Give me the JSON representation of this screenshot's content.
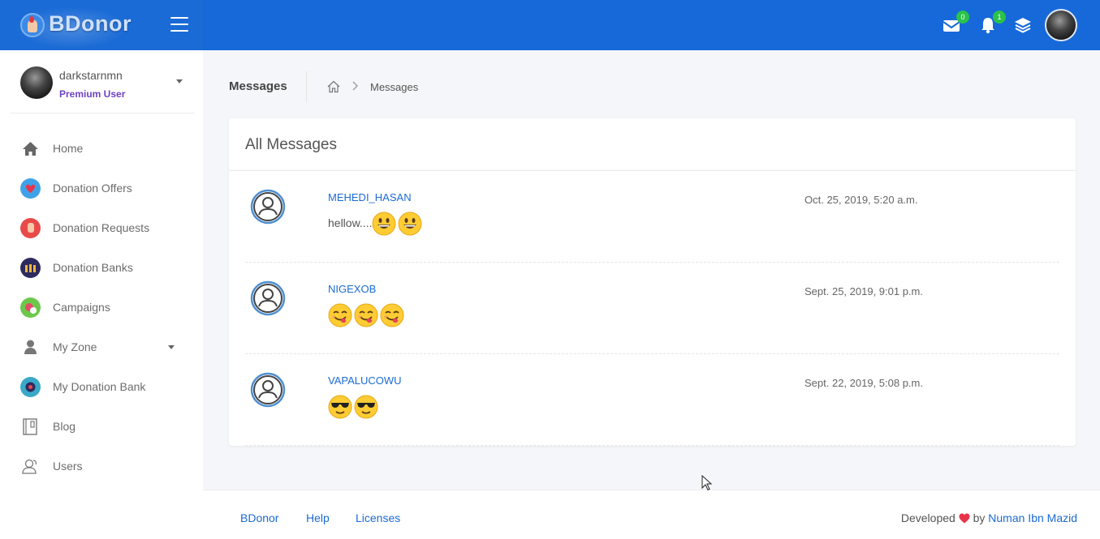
{
  "brand": {
    "name": "BDonor"
  },
  "header": {
    "mail_count": "0",
    "notification_count": "1"
  },
  "user": {
    "name": "darkstarnmn",
    "role": "Premium User"
  },
  "sidebar": {
    "items": [
      {
        "label": "Home",
        "icon": "home-icon"
      },
      {
        "label": "Donation Offers",
        "icon": "heart-hand-icon"
      },
      {
        "label": "Donation Requests",
        "icon": "hand-request-icon"
      },
      {
        "label": "Donation Banks",
        "icon": "people-bank-icon"
      },
      {
        "label": "Campaigns",
        "icon": "campaign-icon"
      },
      {
        "label": "My Zone",
        "icon": "user-icon"
      },
      {
        "label": "My Donation Bank",
        "icon": "bank-icon"
      },
      {
        "label": "Blog",
        "icon": "notebook-icon"
      },
      {
        "label": "Users",
        "icon": "users-icon"
      }
    ]
  },
  "page": {
    "title": "Messages",
    "breadcrumb_current": "Messages"
  },
  "card": {
    "title": "All Messages"
  },
  "messages": [
    {
      "sender": "MEHEDI_HASAN",
      "text": "hellow....",
      "date": "Oct. 25, 2019, 5:20 a.m.",
      "emoji": "grinning",
      "emoji_count": 2
    },
    {
      "sender": "NIGEXOB",
      "text": "",
      "date": "Sept. 25, 2019, 9:01 p.m.",
      "emoji": "yum",
      "emoji_count": 3
    },
    {
      "sender": "VAPALUCOWU",
      "text": "",
      "date": "Sept. 22, 2019, 5:08 p.m.",
      "emoji": "sunglasses",
      "emoji_count": 2
    }
  ],
  "footer": {
    "links": [
      "BDonor",
      "Help",
      "Licenses"
    ],
    "developed": "Developed",
    "by": "by",
    "author": "Numan Ibn Mazid"
  },
  "colors": {
    "primary": "#1769d9",
    "badge": "#2bc24a",
    "premium": "#6f42c1",
    "link": "#1c6ad4"
  }
}
